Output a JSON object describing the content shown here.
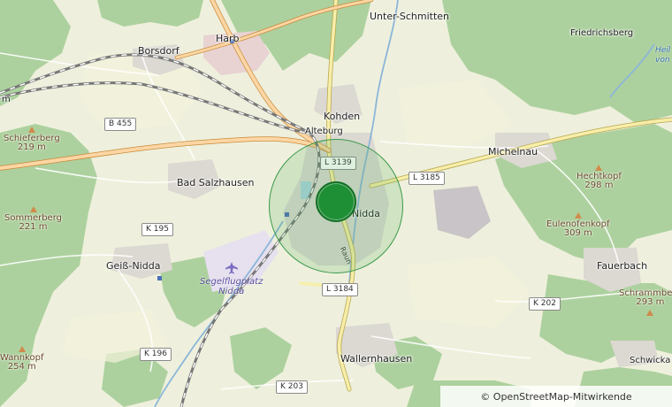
{
  "map": {
    "marker_color": "#1f8f36",
    "attribution": "© OpenStreetMap-Mitwirkende",
    "places": {
      "unter_schmitten": "Unter-Schmitten",
      "borsdorf": "Borsdorf",
      "harb": "Harb",
      "kohden": "Kohden",
      "alteburg": "Alteburg",
      "bad_salzhausen": "Bad Salzhausen",
      "michelnau": "Michelnau",
      "nidda": "Nidda",
      "geiss_nidda": "Geiß-Nidda",
      "fauerbach": "Fauerbach",
      "wallernhausen": "Wallernhausen",
      "schwickartshausen_partial": "Schwicka",
      "friedrichsberg": "Friedrichsberg",
      "edge_partial": "m"
    },
    "peaks": {
      "schieferberg": {
        "name": "Schieferberg",
        "elev": "219 m"
      },
      "sommerberg": {
        "name": "Sommerberg",
        "elev": "221 m"
      },
      "wannkopf": {
        "name": "Wannkopf",
        "elev": "254 m"
      },
      "hechtkopf": {
        "name": "Hechtkopf",
        "elev": "298 m"
      },
      "eulenofenkopf": {
        "name": "Eulenofenkopf",
        "elev": "309 m"
      },
      "schrammberg": {
        "name": "Schrammberg",
        "elev": "293 m"
      }
    },
    "roads": {
      "b455": "B 455",
      "l3139": "L 3139",
      "l3185": "L 3185",
      "k195": "K 195",
      "l3184": "L 3184",
      "k202": "K 202",
      "k196": "K 196",
      "k203": "K 203"
    },
    "airfield": {
      "line1": "Segelflugplatz",
      "line2": "Nidda"
    },
    "river": "Raun",
    "corner_label": {
      "line1": "Heil",
      "line2": "von"
    }
  }
}
